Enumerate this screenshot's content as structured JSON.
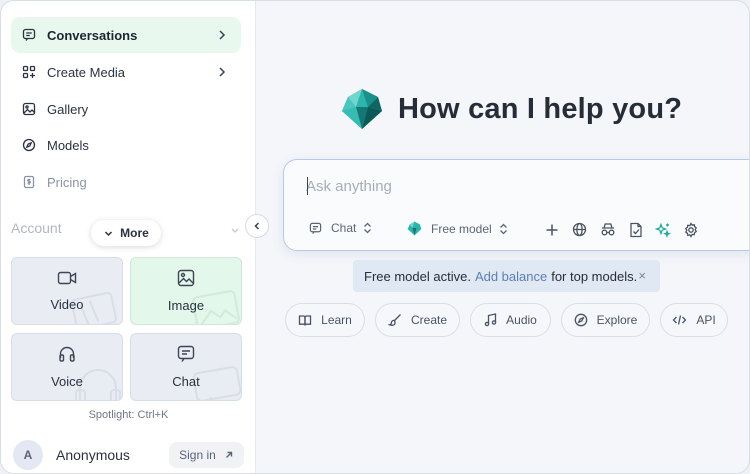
{
  "sidebar": {
    "nav": [
      {
        "label": "Conversations",
        "icon": "chat-bubble-icon"
      },
      {
        "label": "Create Media",
        "icon": "grid-plus-icon"
      },
      {
        "label": "Gallery",
        "icon": "image-icon"
      },
      {
        "label": "Models",
        "icon": "compass-icon"
      },
      {
        "label": "Pricing",
        "icon": "dollar-doc-icon"
      }
    ],
    "account_label": "Account",
    "more_label": "More",
    "tiles": [
      {
        "label": "Video",
        "icon": "video-icon"
      },
      {
        "label": "Image",
        "icon": "image-icon"
      },
      {
        "label": "Voice",
        "icon": "headphones-icon"
      },
      {
        "label": "Chat",
        "icon": "chat-icon"
      }
    ],
    "spotlight": "Spotlight: Ctrl+K",
    "user": {
      "avatar_letter": "A",
      "name": "Anonymous",
      "signin_label": "Sign in"
    }
  },
  "main": {
    "heading": "How can I help you?",
    "prompt": {
      "placeholder": "Ask anything",
      "mode_label": "Chat",
      "model_label": "Free model"
    },
    "notice": {
      "text_before": "Free model active.",
      "link": "Add balance",
      "text_after": "for top models.",
      "close": "×"
    },
    "chips": [
      {
        "label": "Learn",
        "icon": "book-icon"
      },
      {
        "label": "Create",
        "icon": "brush-icon"
      },
      {
        "label": "Audio",
        "icon": "music-note-icon"
      },
      {
        "label": "Explore",
        "icon": "compass-icon"
      },
      {
        "label": "API",
        "icon": "code-icon"
      }
    ]
  },
  "colors": {
    "active_nav_bg": "#e8f8ee",
    "green_tile_bg": "#e3f7ea",
    "prompt_border": "#b9c8ea",
    "notice_bg": "#dfe8f3",
    "brand_teal": "#1aa7a0"
  }
}
